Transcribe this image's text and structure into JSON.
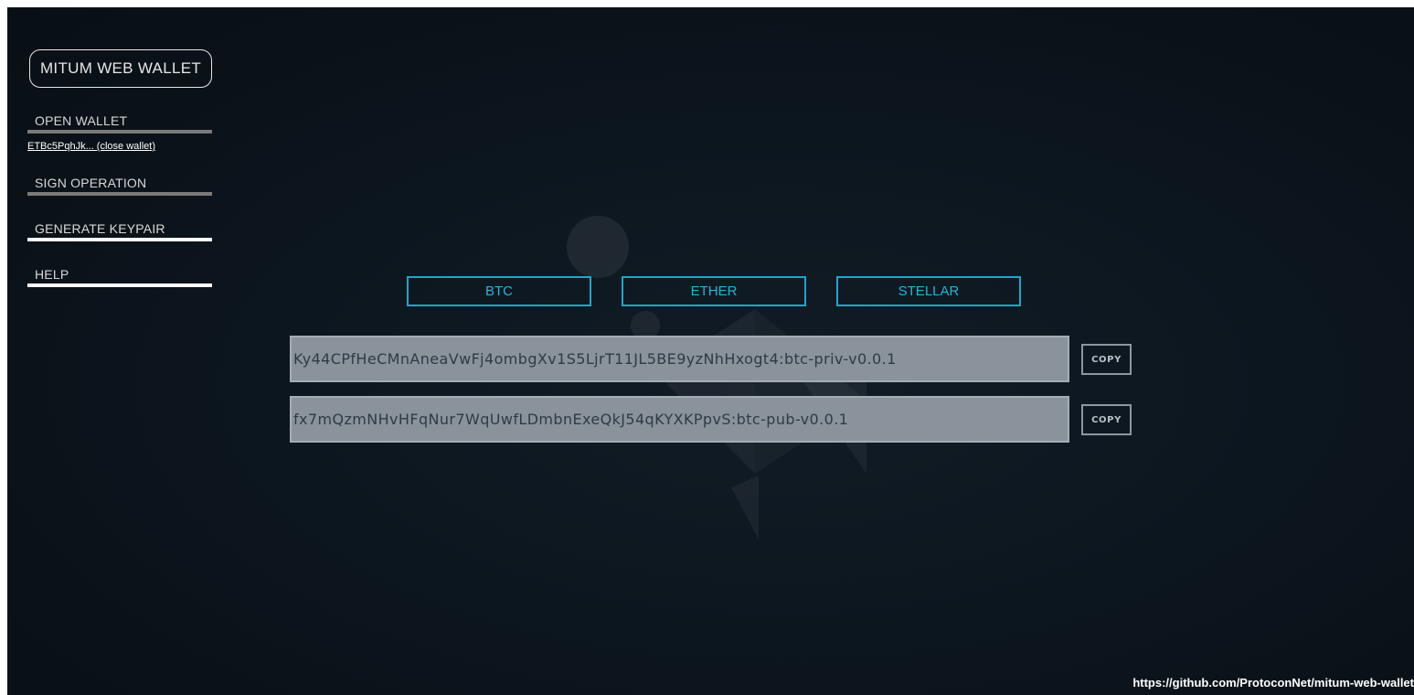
{
  "app": {
    "title": "MITUM WEB WALLET"
  },
  "sidebar": {
    "items": [
      {
        "label": "OPEN WALLET"
      },
      {
        "label": "SIGN OPERATION"
      },
      {
        "label": "GENERATE KEYPAIR"
      },
      {
        "label": "HELP"
      }
    ],
    "wallet_link": "ETBc5PqhJk... (close wallet)"
  },
  "coin_tabs": [
    {
      "label": "BTC"
    },
    {
      "label": "ETHER"
    },
    {
      "label": "STELLAR"
    }
  ],
  "keys": {
    "private_value": "Ky44CPfHeCMnAneaVwFj4ombgXv1S5LjrT11JL5BE9yzNhHxogt4:btc-priv-v0.0.1",
    "public_value": "fx7mQzmNHvHFqNur7WqUwfLDmbnExeQkJ54qKYXKPpvS:btc-pub-v0.0.1",
    "copy_label": "COPY"
  },
  "footer": {
    "link": "https://github.com/ProtoconNet/mitum-web-wallet"
  },
  "colors": {
    "accent": "#1ea7c9",
    "background": "#0d1720",
    "field": "#8a939b"
  },
  "icons": {
    "watermark": "mitum-logo-icon"
  }
}
